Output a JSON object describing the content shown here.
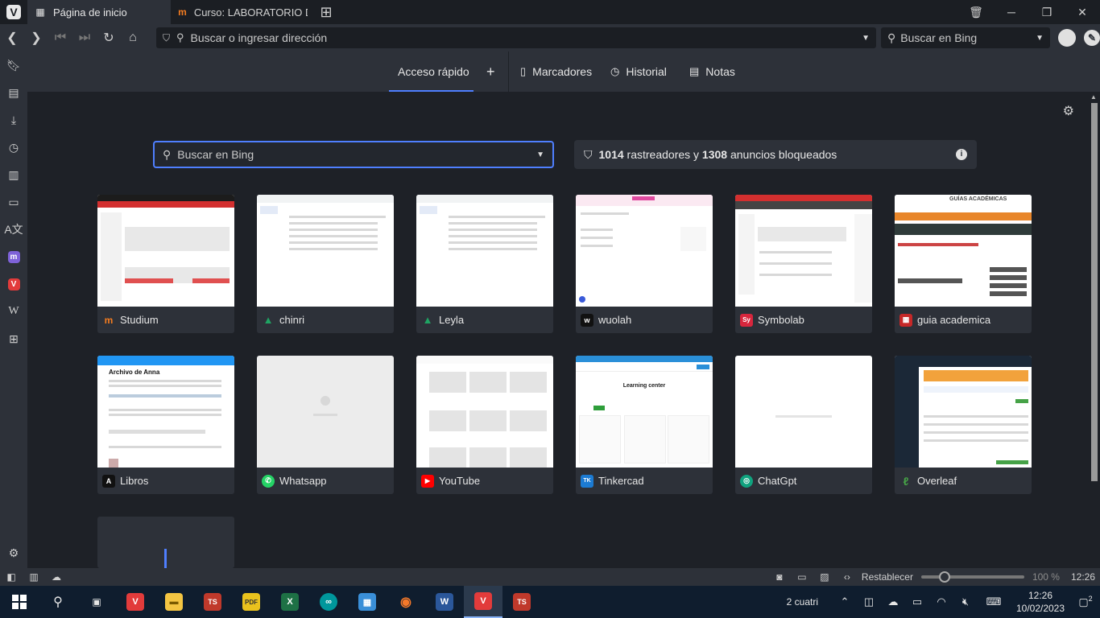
{
  "tabs": [
    {
      "title": "Página de inicio",
      "icon": "grid-icon"
    },
    {
      "title": "Curso: LABORATORIO DE TÉ",
      "icon": "moodle-icon"
    }
  ],
  "address": {
    "placeholder": "Buscar o ingresar dirección"
  },
  "search_engine": {
    "placeholder": "Buscar en Bing"
  },
  "start_header": {
    "tabs": [
      "Acceso rápido",
      "+",
      "Marcadores",
      "Historial",
      "Notas"
    ]
  },
  "page_search": {
    "placeholder": "Buscar en Bing"
  },
  "tracker": {
    "trackers": "1014",
    "middle": "rastreadores y",
    "ads": "1308",
    "suffix": "anuncios bloqueados"
  },
  "speed_dials": [
    {
      "name": "Studium",
      "fav": "m",
      "color": "#f47c20"
    },
    {
      "name": "chinri",
      "fav": "▲",
      "color": "#1fa463"
    },
    {
      "name": "Leyla",
      "fav": "▲",
      "color": "#1fa463"
    },
    {
      "name": "wuolah",
      "fav": "w",
      "color": "#111111"
    },
    {
      "name": "Symbolab",
      "fav": "Sy",
      "color": "#d7263d"
    },
    {
      "name": "guia academica",
      "fav": "▦",
      "color": "#c62828"
    },
    {
      "name": "Libros",
      "fav": "A",
      "color": "#111111"
    },
    {
      "name": "Whatsapp",
      "fav": "✆",
      "color": "#25d366"
    },
    {
      "name": "YouTube",
      "fav": "▶",
      "color": "#ff0000"
    },
    {
      "name": "Tinkercad",
      "fav": "TK",
      "color": "#1c7bd3"
    },
    {
      "name": "ChatGpt",
      "fav": "◎",
      "color": "#10a37f"
    },
    {
      "name": "Overleaf",
      "fav": "ℓ",
      "color": "#46a247"
    }
  ],
  "thumb_texts": {
    "archivo": "Archivo de Anna",
    "learning": "Learning center",
    "guias": "GUÍAS ACADÉMICAS"
  },
  "status": {
    "reset": "Restablecer",
    "zoom": "100 %",
    "time": "12:26"
  },
  "taskbar": {
    "weather": "2 cuatri",
    "time": "12:26",
    "date": "10/02/2023",
    "notif": "2"
  }
}
